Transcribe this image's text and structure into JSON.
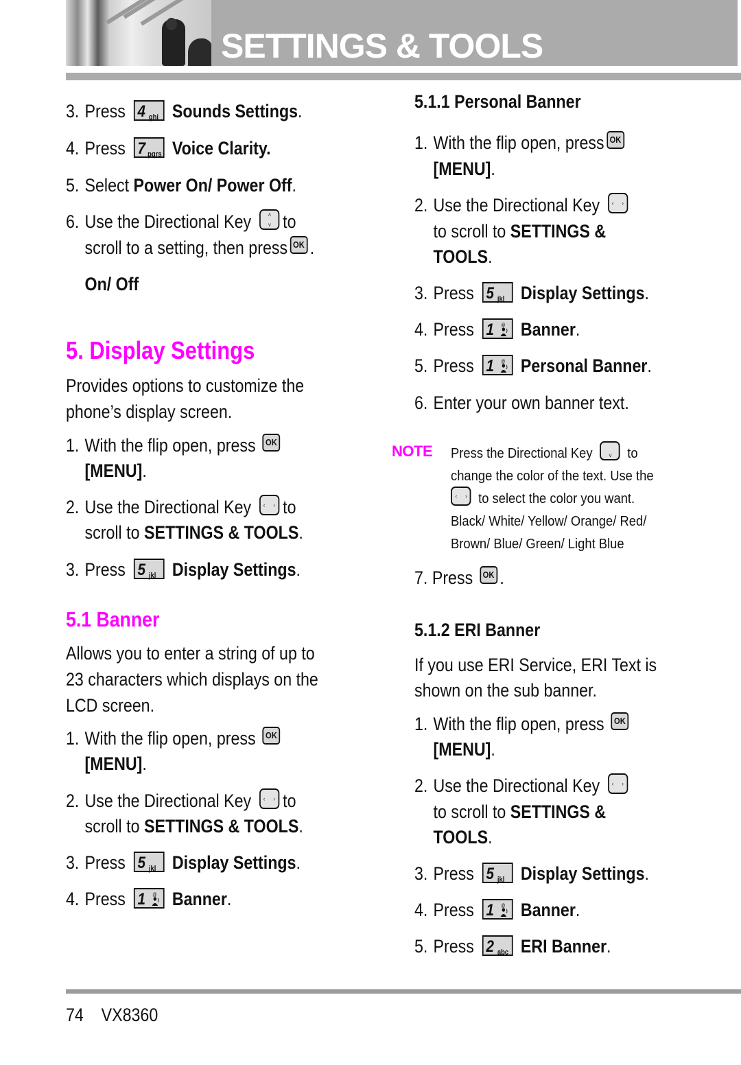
{
  "header": {
    "title": "SETTINGS & TOOLS",
    "photo": "person-in-architecture-photo"
  },
  "colors": {
    "accent": "#ff00ff",
    "header_gray": "#ababab",
    "key_fill": "#d8d8d8"
  },
  "left": {
    "steps_top": [
      {
        "num": "3.",
        "pre": "Press",
        "key": {
          "digit": "4",
          "letters": "ghi"
        },
        "bold": "Sounds Settings",
        "post": "."
      },
      {
        "num": "4.",
        "pre": "Press",
        "key": {
          "digit": "7",
          "letters": "pqrs"
        },
        "bold": "Voice Clarity.",
        "post": ""
      },
      {
        "num": "5.",
        "pre": "Select",
        "bold": "Power On/ Power Off",
        "post": "."
      },
      {
        "num": "6.",
        "pre": "Use the Directional Key",
        "post": "to",
        "line2_pre": "scroll to a setting, then press",
        "line2_post": "."
      }
    ],
    "option": "On/ Off",
    "display_settings": {
      "heading": "5. Display Settings",
      "desc_lines": [
        "Provides options to customize the",
        "phone’s display screen."
      ],
      "steps": [
        {
          "num": "1.",
          "pre": "With the flip open, press",
          "line2_bold": "[MENU]",
          "line2_post": "."
        },
        {
          "num": "2.",
          "pre": "Use the Directional Key",
          "post": "to",
          "line2_pre": "scroll to ",
          "line2_bold": "SETTINGS & TOOLS",
          "line2_post": "."
        },
        {
          "num": "3.",
          "pre": "Press",
          "key": {
            "digit": "5",
            "letters": "jkl"
          },
          "bold": "Display Settings",
          "post": "."
        }
      ]
    },
    "banner": {
      "heading": "5.1 Banner",
      "desc_lines": [
        "Allows you to enter a string of up to",
        "23 characters which displays on the",
        "LCD screen."
      ],
      "steps": [
        {
          "num": "1.",
          "pre": "With the flip open, press",
          "line2_bold": "[MENU]",
          "line2_post": "."
        },
        {
          "num": "2.",
          "pre": "Use the Directional Key",
          "post": "to",
          "line2_pre": "scroll to ",
          "line2_bold": "SETTINGS & TOOLS",
          "line2_post": "."
        },
        {
          "num": "3.",
          "pre": "Press",
          "key": {
            "digit": "5",
            "letters": "jkl"
          },
          "bold": "Display Settings",
          "post": "."
        },
        {
          "num": "4.",
          "pre": "Press",
          "key": {
            "digit": "1",
            "letters": ""
          },
          "bold": "Banner",
          "post": "."
        }
      ]
    }
  },
  "right": {
    "personal_banner": {
      "heading": "5.1.1 Personal Banner",
      "steps": [
        {
          "num": "1.",
          "pre": "With the flip open, press",
          "line2_bold": "[MENU]",
          "line2_post": "."
        },
        {
          "num": "2.",
          "pre": "Use the Directional Key",
          "line2_pre": "to scroll to ",
          "line2_bold": "SETTINGS &",
          "line3_bold": "TOOLS",
          "line3_post": "."
        },
        {
          "num": "3.",
          "pre": "Press",
          "key": {
            "digit": "5",
            "letters": "jkl"
          },
          "bold": "Display Settings",
          "post": "."
        },
        {
          "num": "4.",
          "pre": "Press",
          "key": {
            "digit": "1",
            "letters": ""
          },
          "bold": "Banner",
          "post": "."
        },
        {
          "num": "5.",
          "pre": "Press",
          "key": {
            "digit": "1",
            "letters": ""
          },
          "bold": "Personal Banner",
          "post": "."
        },
        {
          "num": "6.",
          "pre": "Enter your own banner text."
        }
      ],
      "note": {
        "label": "NOTE",
        "lines": [
          {
            "pre": "Press the Directional Key",
            "post": "to"
          },
          {
            "pre": "change the color of the text. Use the"
          },
          {
            "post": "to select the color you want."
          },
          {
            "pre": "Black/ White/ Yellow/ Orange/ Red/"
          },
          {
            "pre": "Brown/ Blue/ Green/ Light Blue"
          }
        ]
      },
      "step7": {
        "num": "7.",
        "pre": "Press",
        "post": "."
      }
    },
    "eri_banner": {
      "heading": "5.1.2 ERI Banner",
      "desc_lines": [
        "If you use ERI Service, ERI Text is",
        "shown on the sub banner."
      ],
      "steps": [
        {
          "num": "1.",
          "pre": "With the flip open, press",
          "line2_bold": "[MENU]",
          "line2_post": "."
        },
        {
          "num": "2.",
          "pre": "Use the Directional Key",
          "line2_pre": "to scroll to ",
          "line2_bold": "SETTINGS &",
          "line3_bold": "TOOLS",
          "line3_post": "."
        },
        {
          "num": "3.",
          "pre": "Press",
          "key": {
            "digit": "5",
            "letters": "jkl"
          },
          "bold": "Display Settings",
          "post": "."
        },
        {
          "num": "4.",
          "pre": "Press",
          "key": {
            "digit": "1",
            "letters": ""
          },
          "bold": "Banner",
          "post": "."
        },
        {
          "num": "5.",
          "pre": "Press",
          "key": {
            "digit": "2",
            "letters": "abc"
          },
          "bold": "ERI Banner",
          "post": "."
        }
      ]
    }
  },
  "footer": {
    "page_number": "74",
    "model": "VX8360"
  },
  "icons": {
    "ok_key": "OK",
    "dir_up": "˄",
    "dir_down": "˅",
    "dir_left": "‹",
    "dir_right": "›"
  }
}
